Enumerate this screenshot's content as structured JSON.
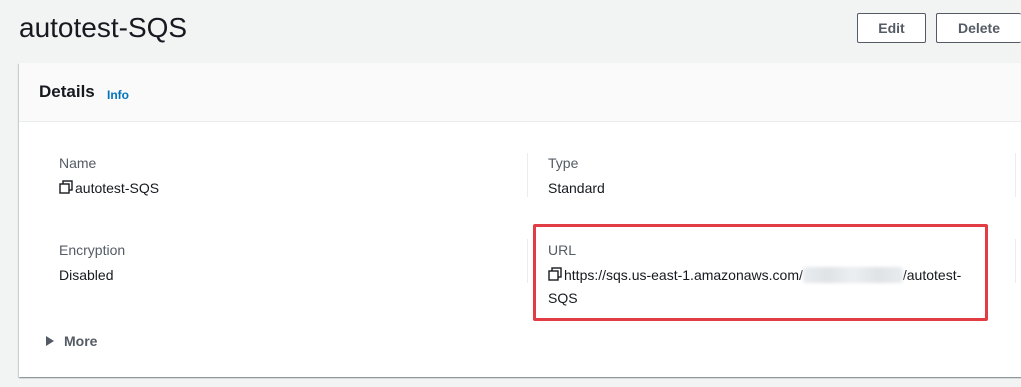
{
  "page": {
    "title": "autotest-SQS"
  },
  "actions": {
    "edit_label": "Edit",
    "delete_label": "Delete"
  },
  "details": {
    "heading": "Details",
    "info_label": "Info",
    "name_label": "Name",
    "name_value": "autotest-SQS",
    "type_label": "Type",
    "type_value": "Standard",
    "encryption_label": "Encryption",
    "encryption_value": "Disabled",
    "url_label": "URL",
    "url_prefix": "https://sqs.us-east-1.amazonaws.com/",
    "url_suffix": "/autotest-SQS",
    "more_label": "More"
  },
  "colors": {
    "accent_link": "#0073bb",
    "highlight": "#e23c44"
  },
  "icons": {
    "copy": "copy-icon",
    "expand": "caret-right-icon"
  }
}
